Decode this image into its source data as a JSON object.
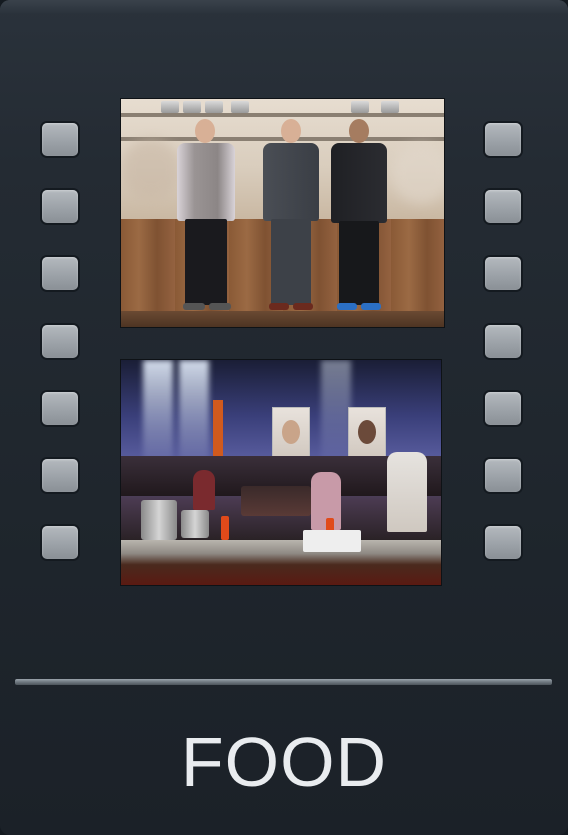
{
  "tile": {
    "title": "FOOD",
    "accent_color": "#e9ecef",
    "background_color": "#1f262d"
  },
  "film_strip": {
    "frames": [
      {
        "name": "judges-kitchen-photo"
      },
      {
        "name": "arena-kitchen-photo"
      }
    ]
  }
}
